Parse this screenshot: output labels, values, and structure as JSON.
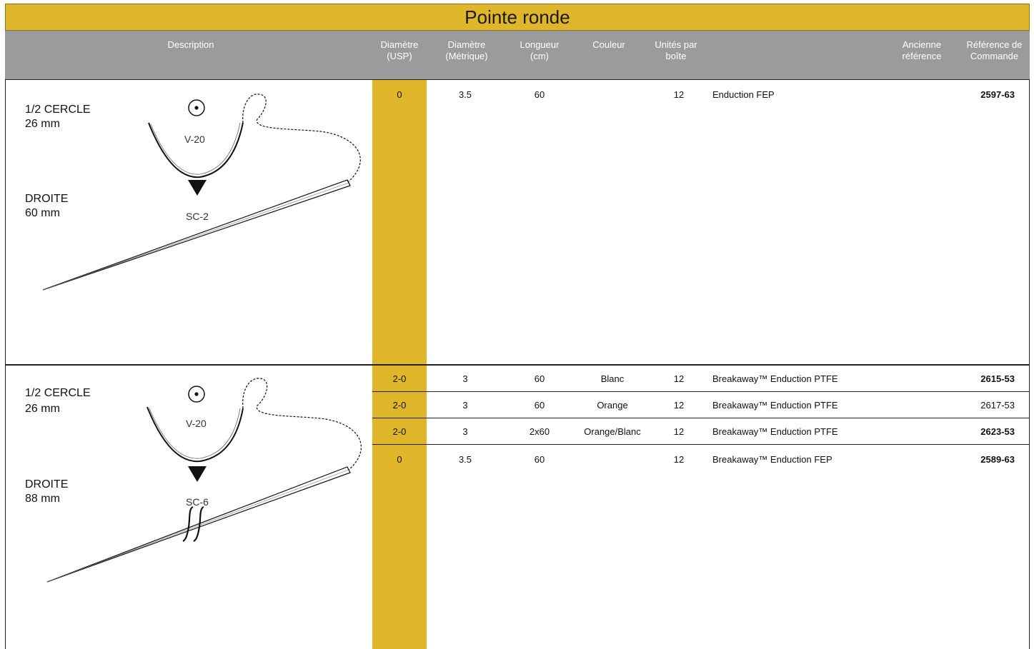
{
  "title": "Pointe ronde",
  "columns": {
    "description": "Description",
    "usp": "Diamètre\n(USP)",
    "metric": "Diamètre\n(Métrique)",
    "length": "Longueur\n(cm)",
    "color": "Couleur",
    "units": "Unités par\nboîte",
    "old_ref": "Ancienne\nréférence",
    "order_ref": "Référence de\nCommande"
  },
  "sections": [
    {
      "needle_top": {
        "shape": "1/2 CERCLE",
        "size": "26 mm",
        "code": "V-20"
      },
      "needle_bottom": {
        "shape": "DROITE",
        "size": "60 mm",
        "code": "SC-2"
      },
      "rows": [
        {
          "usp": "0",
          "metric": "3.5",
          "length": "60",
          "color": "",
          "units": "12",
          "product": "Enduction FEP",
          "ref": "2597-63",
          "bold": true
        }
      ]
    },
    {
      "needle_top": {
        "shape": "1/2 CERCLE",
        "size": "26 mm",
        "code": "V-20"
      },
      "needle_bottom": {
        "shape": "DROITE",
        "size": "88 mm",
        "code": "SC-6"
      },
      "rows": [
        {
          "usp": "2-0",
          "metric": "3",
          "length": "60",
          "color": "Blanc",
          "units": "12",
          "product": "Breakaway™ Enduction PTFE",
          "ref": "2615-53",
          "bold": true
        },
        {
          "usp": "2-0",
          "metric": "3",
          "length": "60",
          "color": "Orange",
          "units": "12",
          "product": "Breakaway™ Enduction PTFE",
          "ref": "2617-53",
          "bold": false
        },
        {
          "usp": "2-0",
          "metric": "3",
          "length": "2x60",
          "color": "Orange/Blanc",
          "units": "12",
          "product": "Breakaway™ Enduction PTFE",
          "ref": "2623-53",
          "bold": true
        },
        {
          "usp": "0",
          "metric": "3.5",
          "length": "60",
          "color": "",
          "units": "12",
          "product": "Breakaway™ Enduction FEP",
          "ref": "2589-63",
          "bold": true
        }
      ]
    }
  ],
  "colors": {
    "accent": "#dfb52a",
    "header": "#9b9b9b"
  },
  "icons": [
    "cross-section-round-icon",
    "arrow-down-triangle-icon",
    "curved-needle-icon",
    "straight-needle-icon",
    "breakaway-clip-icon"
  ]
}
